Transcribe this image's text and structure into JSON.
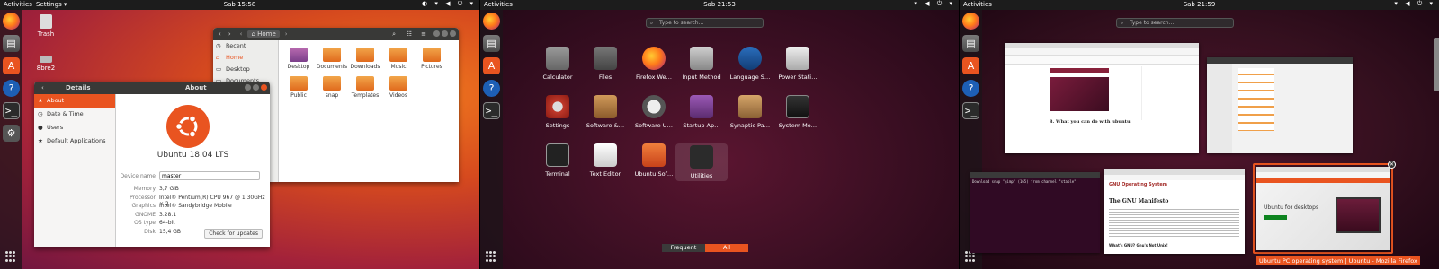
{
  "panel1": {
    "topbar": {
      "activities": "Activities",
      "app_menu": "Settings ▾",
      "clock": "Sab 15:58"
    },
    "desktop": {
      "trash_label": "Trash",
      "drive_label": "8bre2"
    },
    "files_window": {
      "path_label": "Home",
      "sidebar": [
        "Recent",
        "Home",
        "Desktop",
        "Documents"
      ],
      "folders": [
        "Desktop",
        "Documents",
        "Downloads",
        "Music",
        "Pictures",
        "Public",
        "snap",
        "Templates",
        "Videos"
      ]
    },
    "settings_window": {
      "left_title": "Details",
      "right_title": "About",
      "sidebar": [
        "About",
        "Date & Time",
        "Users",
        "Default Applications"
      ],
      "os_name": "Ubuntu 18.04 LTS",
      "device_name_label": "Device name",
      "device_name_value": "master",
      "rows": [
        {
          "label": "Memory",
          "value": "3,7 GiB"
        },
        {
          "label": "Processor",
          "value": "Intel® Pentium(R) CPU 967 @ 1.30GHz × 2"
        },
        {
          "label": "Graphics",
          "value": "Intel® Sandybridge Mobile"
        },
        {
          "label": "GNOME",
          "value": "3.28.1"
        },
        {
          "label": "OS type",
          "value": "64-bit"
        },
        {
          "label": "Disk",
          "value": "15,4 GB"
        }
      ],
      "update_button": "Check for updates"
    }
  },
  "panel2": {
    "topbar": {
      "activities": "Activities",
      "clock": "Sab 21:53"
    },
    "search_placeholder": "Type to search…",
    "apps": [
      "Calculator",
      "Files",
      "Firefox We…",
      "Input Method",
      "Language S…",
      "Power Stati…",
      "Settings",
      "Software &…",
      "Software U…",
      "Startup Ap…",
      "Synaptic Pa…",
      "System Mo…",
      "Terminal",
      "Text Editor",
      "Ubuntu Sof…",
      "Utilities"
    ],
    "tabs": [
      "Frequent",
      "All"
    ]
  },
  "panel3": {
    "topbar": {
      "activities": "Activities",
      "clock": "Sab 21:59"
    },
    "search_placeholder": "Type to search…",
    "window_texts": {
      "blog_heading": "8. What you can do with ubuntu",
      "gnu_heading": "The GNU Manifesto",
      "gnu_sub": "What's GNU? Gnu's Not Unix!",
      "gnu_site": "GNU Operating System",
      "ubuntu_page": "Ubuntu for desktops",
      "terminal_line": "Download snap \"gimp\" (165) from channel \"stable\""
    },
    "caption": "Ubuntu PC operating system | Ubuntu - Mozilla Firefox"
  }
}
